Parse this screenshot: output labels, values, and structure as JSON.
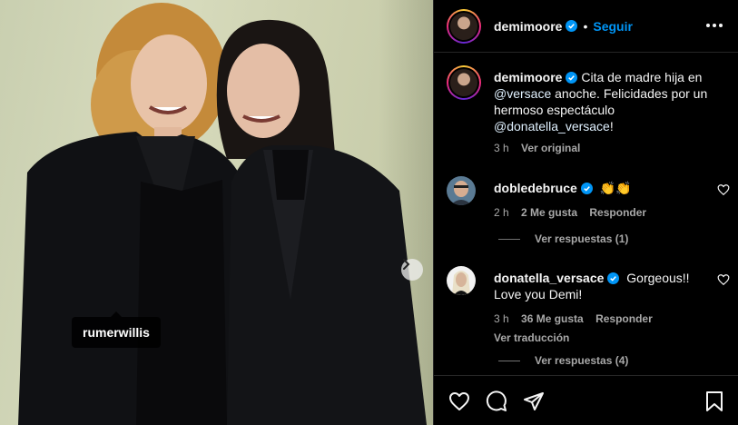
{
  "photo": {
    "tag_username": "rumerwillis"
  },
  "header": {
    "username": "demimoore",
    "separator": "•",
    "follow_label": "Seguir"
  },
  "caption": {
    "username": "demimoore",
    "text_before": " Cita de madre hija en ",
    "mention1": "@versace",
    "text_middle": " anoche. Felicidades por un hermoso espectáculo ",
    "mention2": "@donatella_versace",
    "text_after": "!",
    "time": "3 h",
    "see_original": "Ver original"
  },
  "comments": [
    {
      "username": "dobledebruce",
      "text": "👏👏",
      "time": "2 h",
      "likes": "2 Me gusta",
      "reply_label": "Responder",
      "view_replies": "Ver respuestas (1)"
    },
    {
      "username": "donatella_versace",
      "text": "Gorgeous!! Love you Demi!",
      "time": "3 h",
      "likes": "36 Me gusta",
      "reply_label": "Responder",
      "translate": "Ver traducción",
      "view_replies": "Ver respuestas (4)"
    }
  ],
  "icons": {
    "verified": "verified-badge-icon",
    "more": "more-options-icon",
    "like": "heart-icon",
    "comment": "comment-icon",
    "share": "share-icon",
    "save": "bookmark-icon",
    "next": "chevron-right-icon"
  },
  "colors": {
    "accent": "#0095f6",
    "background": "#000000",
    "secondary_text": "#a8a8a8"
  }
}
